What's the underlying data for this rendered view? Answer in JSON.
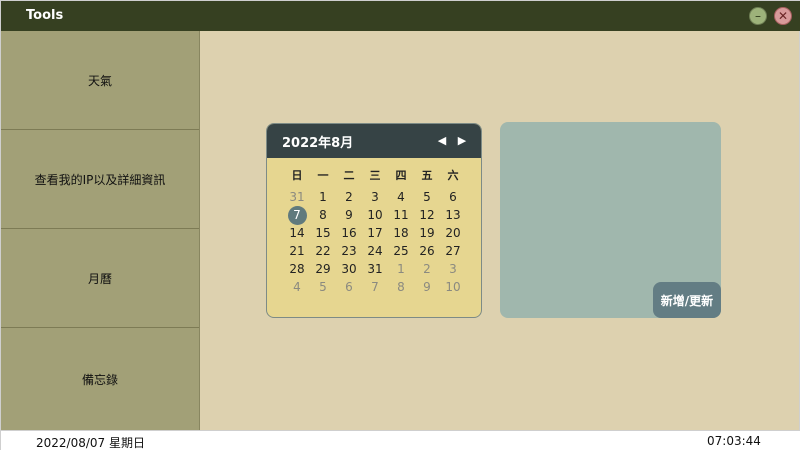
{
  "window": {
    "title": "Tools",
    "minimize_symbol": "–",
    "close_symbol": "✕",
    "colors": {
      "titlebar": "#364021",
      "content": "#ddd1af",
      "sidebar": "#a2a077"
    }
  },
  "sidebar": {
    "items": [
      {
        "label": "天氣"
      },
      {
        "label": "查看我的IP以及詳細資訊"
      },
      {
        "label": "月曆"
      },
      {
        "label": "備忘錄"
      }
    ]
  },
  "calendar": {
    "month_label": "2022年8月",
    "prev_icon": "◀",
    "next_icon": "▶",
    "weekdays": [
      "日",
      "一",
      "二",
      "三",
      "四",
      "五",
      "六"
    ],
    "weeks": [
      [
        {
          "d": "31",
          "other": true
        },
        {
          "d": "1"
        },
        {
          "d": "2"
        },
        {
          "d": "3"
        },
        {
          "d": "4"
        },
        {
          "d": "5"
        },
        {
          "d": "6"
        }
      ],
      [
        {
          "d": "7",
          "today": true
        },
        {
          "d": "8"
        },
        {
          "d": "9"
        },
        {
          "d": "10"
        },
        {
          "d": "11"
        },
        {
          "d": "12"
        },
        {
          "d": "13"
        }
      ],
      [
        {
          "d": "14"
        },
        {
          "d": "15"
        },
        {
          "d": "16"
        },
        {
          "d": "17"
        },
        {
          "d": "18"
        },
        {
          "d": "19"
        },
        {
          "d": "20"
        }
      ],
      [
        {
          "d": "21"
        },
        {
          "d": "22"
        },
        {
          "d": "23"
        },
        {
          "d": "24"
        },
        {
          "d": "25"
        },
        {
          "d": "26"
        },
        {
          "d": "27"
        }
      ],
      [
        {
          "d": "28"
        },
        {
          "d": "29"
        },
        {
          "d": "30"
        },
        {
          "d": "31"
        },
        {
          "d": "1",
          "other": true
        },
        {
          "d": "2",
          "other": true
        },
        {
          "d": "3",
          "other": true
        }
      ],
      [
        {
          "d": "4",
          "other": true
        },
        {
          "d": "5",
          "other": true
        },
        {
          "d": "6",
          "other": true
        },
        {
          "d": "7",
          "other": true
        },
        {
          "d": "8",
          "other": true
        },
        {
          "d": "9",
          "other": true
        },
        {
          "d": "10",
          "other": true
        }
      ]
    ],
    "colors": {
      "body": "#e6d690",
      "header": "#364345",
      "today": "#607a7d"
    }
  },
  "memo": {
    "button_label": "新增/更新",
    "colors": {
      "panel": "#a0b7ad",
      "button": "#637d84"
    }
  },
  "statusbar": {
    "date": "2022/08/07 星期日",
    "time": "07:03:44"
  }
}
